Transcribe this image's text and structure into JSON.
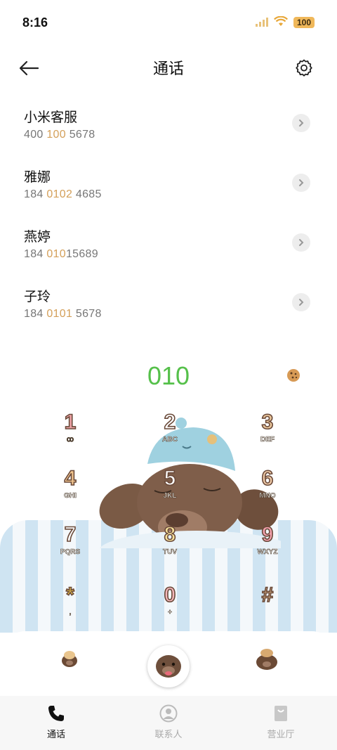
{
  "status": {
    "time": "8:16",
    "battery": "100"
  },
  "header": {
    "title": "通话"
  },
  "contacts": [
    {
      "name": "小米客服",
      "num_parts": [
        "400 ",
        "100",
        " 5678"
      ]
    },
    {
      "name": "雅娜",
      "num_parts": [
        "184 ",
        "0102",
        " 4685"
      ]
    },
    {
      "name": "燕婷",
      "num_parts": [
        "184 ",
        "010",
        "15689"
      ]
    },
    {
      "name": "子玲",
      "num_parts": [
        "184 ",
        "0101",
        " 5678"
      ]
    }
  ],
  "dial": {
    "display": "010"
  },
  "keypad": [
    {
      "digit": "1",
      "letters": "ꝏ",
      "color": "#f0a3a8"
    },
    {
      "digit": "2",
      "letters": "ABC",
      "color": "#ffffff"
    },
    {
      "digit": "3",
      "letters": "DEF",
      "color": "#e9c59a"
    },
    {
      "digit": "4",
      "letters": "GHI",
      "color": "#f1c58f"
    },
    {
      "digit": "5",
      "letters": "JKL",
      "color": "#ffffff"
    },
    {
      "digit": "6",
      "letters": "MNO",
      "color": "#ecc7a4"
    },
    {
      "digit": "7",
      "letters": "PQRS",
      "color": "#ffffff"
    },
    {
      "digit": "8",
      "letters": "TUV",
      "color": "#f6e09a"
    },
    {
      "digit": "9",
      "letters": "WXYZ",
      "color": "#f2a0ac"
    },
    {
      "digit": "*",
      "letters": ",",
      "color": "#f2cc4a"
    },
    {
      "digit": "0",
      "letters": "+",
      "color": "#f4b7bb"
    },
    {
      "digit": "#",
      "letters": "",
      "color": "#d9b48a"
    }
  ],
  "tabs": [
    {
      "label": "通话",
      "icon": "phone-icon",
      "active": true
    },
    {
      "label": "联系人",
      "icon": "person-icon",
      "active": false
    },
    {
      "label": "营业厅",
      "icon": "bag-icon",
      "active": false
    }
  ],
  "colors": {
    "accent_green": "#55c04a",
    "highlight": "#d4a05a"
  }
}
